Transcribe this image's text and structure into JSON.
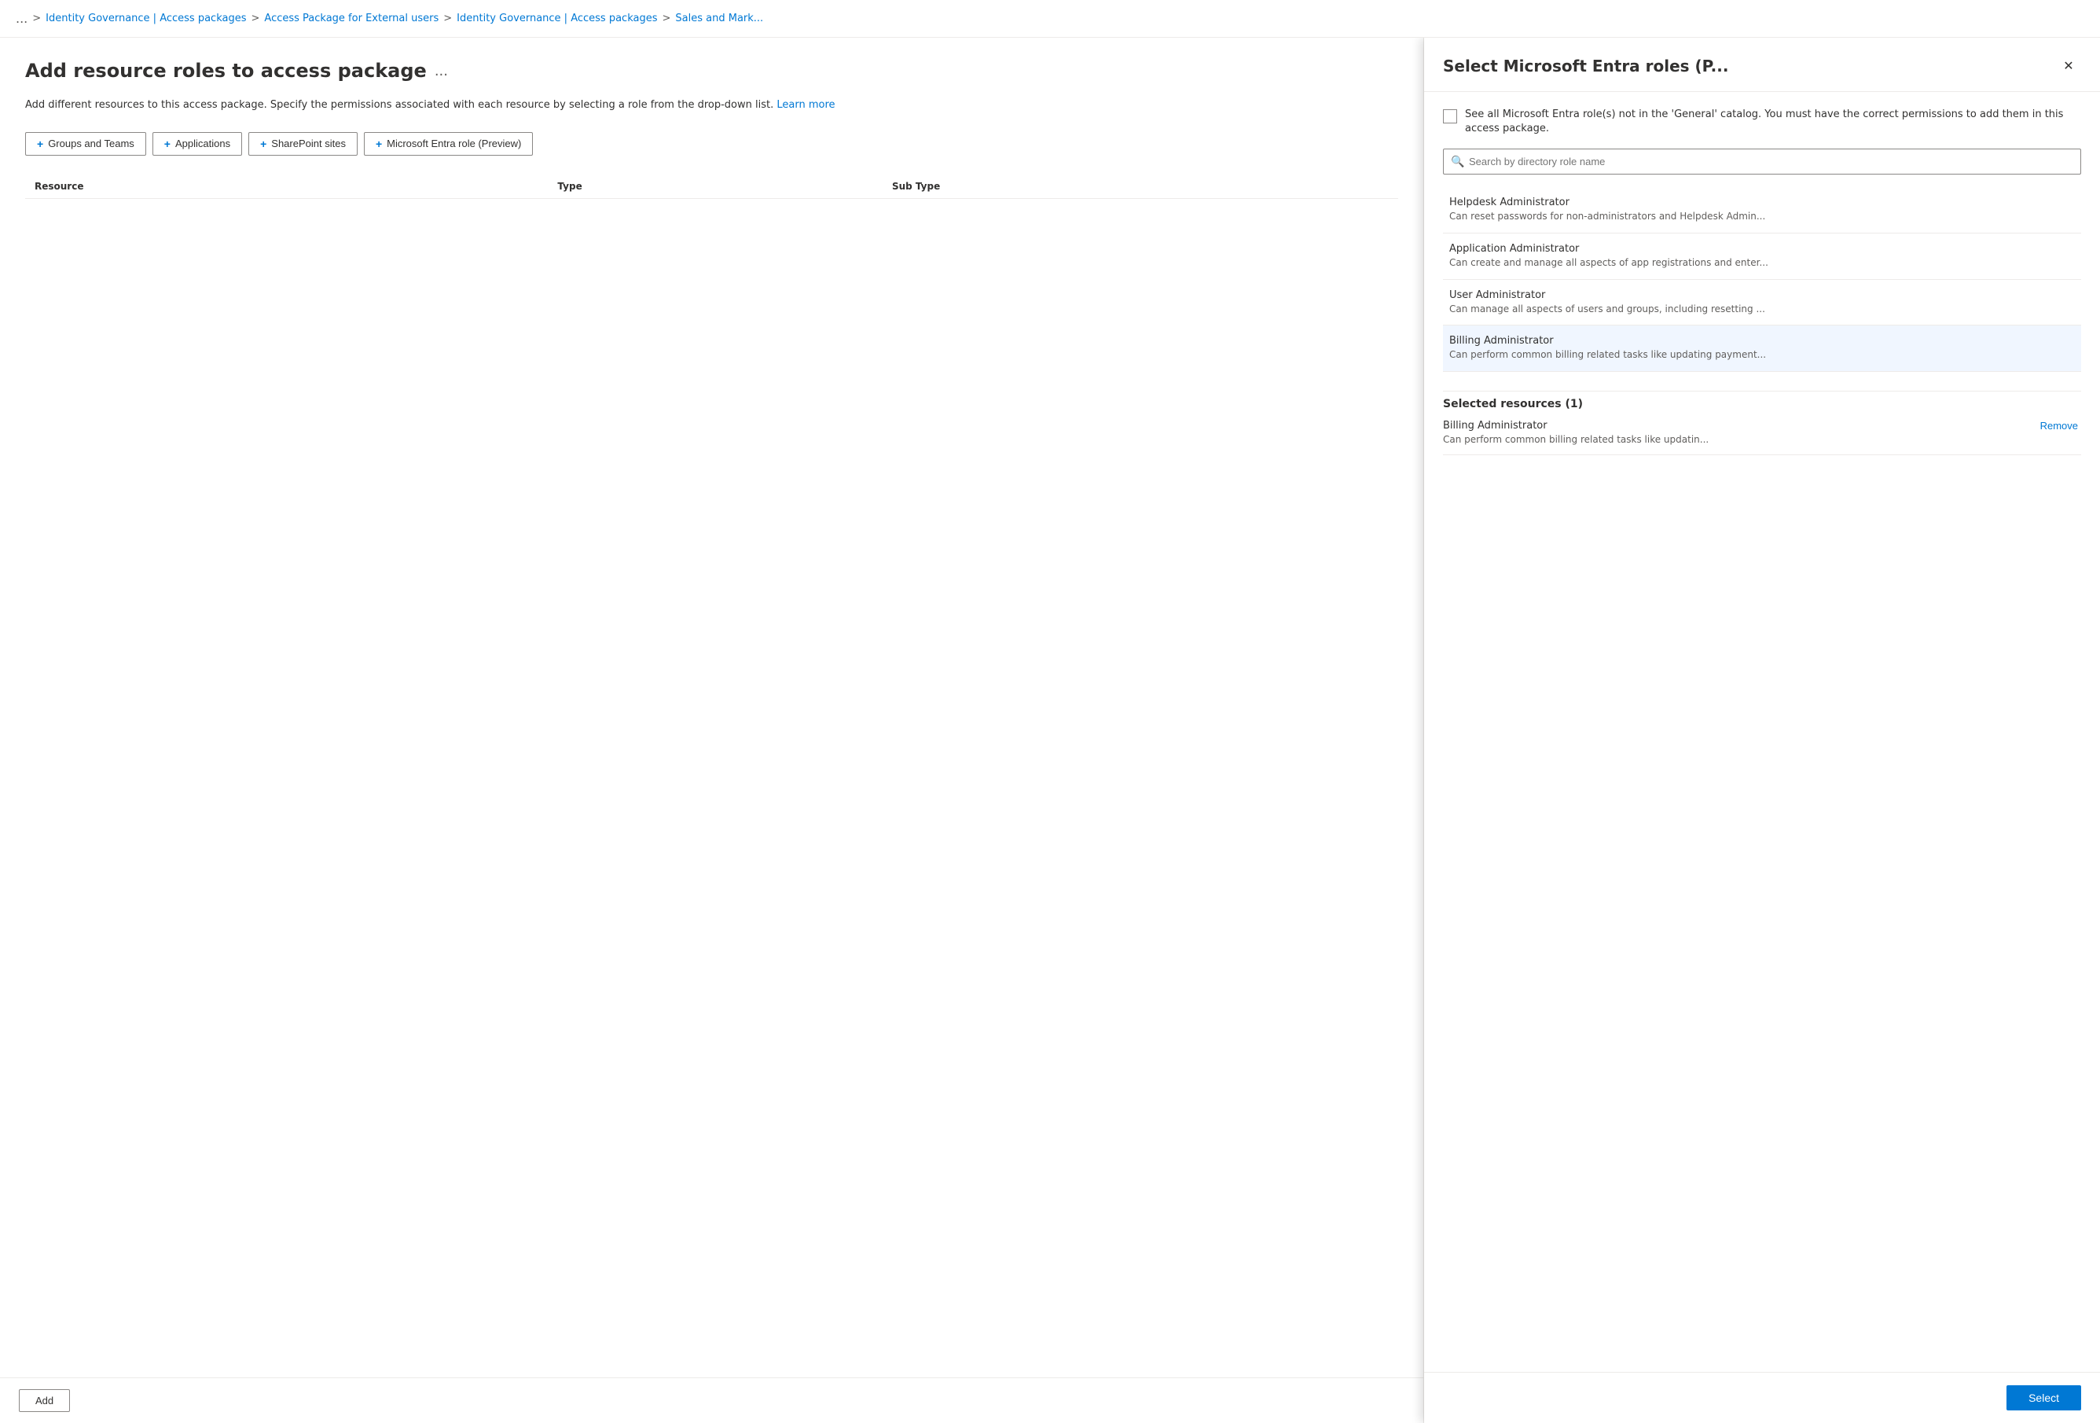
{
  "breadcrumb": {
    "ellipsis": "...",
    "items": [
      {
        "label": "Identity Governance | Access packages",
        "url": "#"
      },
      {
        "label": "Access Package for External users",
        "url": "#"
      },
      {
        "label": "Identity Governance | Access packages",
        "url": "#"
      },
      {
        "label": "Sales and Mark...",
        "url": "#"
      }
    ],
    "separator": ">"
  },
  "page": {
    "title": "Add resource roles to access package",
    "title_ellipsis": "...",
    "description": "Add different resources to this access package. Specify the permissions associated with each resource by selecting a role from the drop-down list.",
    "description_link": "Learn more",
    "table": {
      "columns": [
        "Resource",
        "Type",
        "Sub Type"
      ]
    }
  },
  "toolbar": {
    "buttons": [
      {
        "id": "groups-teams",
        "label": "Groups and Teams"
      },
      {
        "id": "applications",
        "label": "Applications"
      },
      {
        "id": "sharepoint-sites",
        "label": "SharePoint sites"
      },
      {
        "id": "entra-role",
        "label": "Microsoft Entra role (Preview)"
      }
    ],
    "plus_icon": "+"
  },
  "bottom_bar": {
    "add_label": "Add"
  },
  "panel": {
    "title": "Select Microsoft Entra roles (P...",
    "close_icon": "✕",
    "checkbox_label": "See all Microsoft Entra role(s) not in the 'General' catalog. You must have the correct permissions to add them in this access package.",
    "search_placeholder": "Search by directory role name",
    "roles": [
      {
        "id": "helpdesk-admin",
        "name": "Helpdesk Administrator",
        "desc": "Can reset passwords for non-administrators and Helpdesk Admin..."
      },
      {
        "id": "app-admin",
        "name": "Application Administrator",
        "desc": "Can create and manage all aspects of app registrations and enter..."
      },
      {
        "id": "user-admin",
        "name": "User Administrator",
        "desc": "Can manage all aspects of users and groups, including resetting ..."
      },
      {
        "id": "billing-admin",
        "name": "Billing Administrator",
        "desc": "Can perform common billing related tasks like updating payment..."
      }
    ],
    "selected_resources_header": "Selected resources (1)",
    "selected_resources": [
      {
        "id": "billing-admin-selected",
        "name": "Billing Administrator",
        "desc": "Can perform common billing related tasks like updatin...",
        "remove_label": "Remove"
      }
    ],
    "select_button_label": "Select"
  }
}
